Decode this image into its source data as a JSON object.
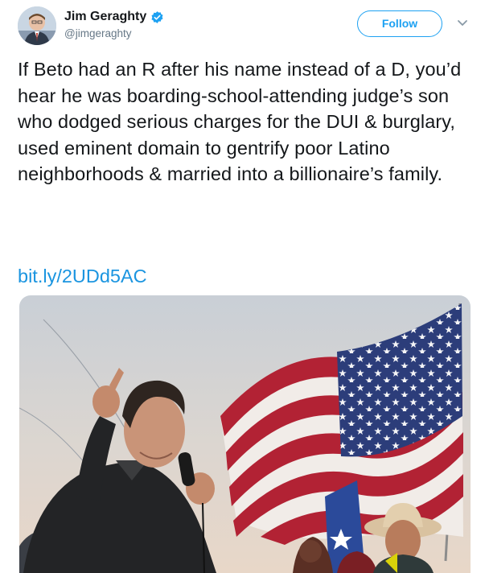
{
  "tweet": {
    "author": {
      "display_name": "Jim Geraghty",
      "handle": "@jimgeraghty",
      "verified": true,
      "verified_icon": "verified-badge-icon"
    },
    "follow_label": "Follow",
    "menu_icon": "chevron-down-icon",
    "text": "If Beto had an R after his name instead of a D, you’d hear he was boarding-school-attending judge’s son who dodged serious charges for the DUI & burglary, used eminent domain to gentrify poor Latino neighborhoods & married into a billionaire’s family.",
    "link": "bit.ly/2UDd5AC",
    "colors": {
      "accent": "#1da1f2",
      "link": "#1b95e0",
      "text": "#14171a",
      "secondary": "#657786"
    }
  }
}
